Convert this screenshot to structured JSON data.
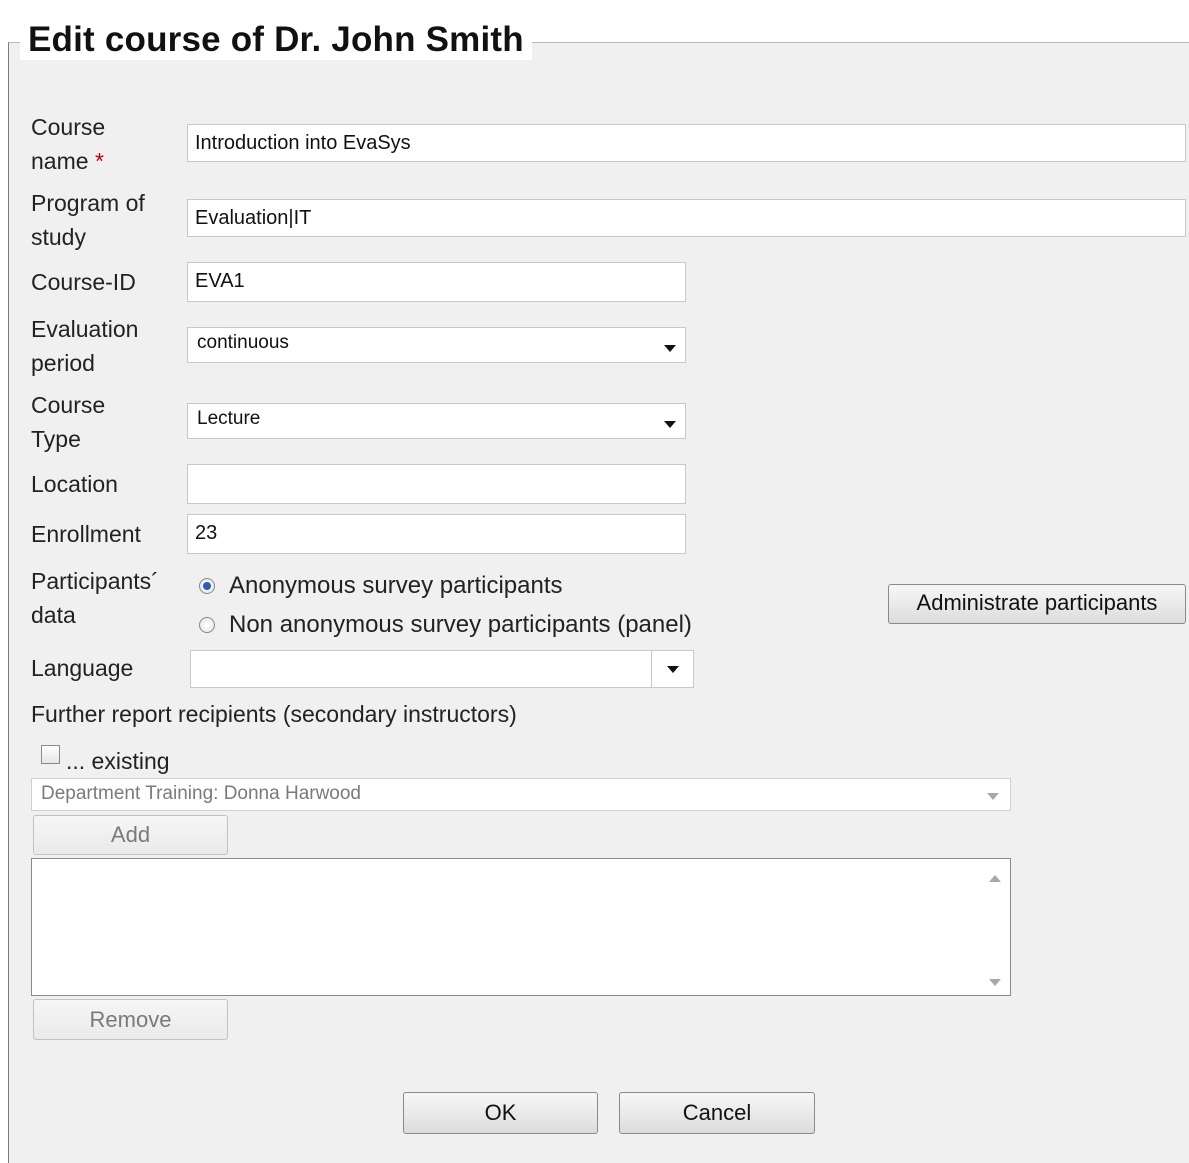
{
  "title": "Edit course of Dr. John Smith",
  "fields": {
    "course_name": {
      "label": "Course name",
      "required_mark": "*",
      "value": "Introduction into EvaSys"
    },
    "program": {
      "label": "Program of study",
      "value": "Evaluation|IT"
    },
    "course_id": {
      "label": "Course-ID",
      "value": "EVA1"
    },
    "evaluation_period": {
      "label": "Evaluation period",
      "value": "continuous"
    },
    "course_type": {
      "label": "Course Type",
      "value": "Lecture"
    },
    "location": {
      "label": "Location",
      "value": ""
    },
    "enrollment": {
      "label": "Enrollment",
      "value": "23"
    },
    "participants": {
      "label": "Participants´ data",
      "option_anonymous": "Anonymous survey participants",
      "option_panel": "Non anonymous survey participants (panel)",
      "selected": "anonymous",
      "admin_button": "Administrate participants"
    },
    "language": {
      "label": "Language",
      "value": ""
    }
  },
  "recipients": {
    "heading": "Further report recipients (secondary instructors)",
    "existing_label": "... existing",
    "existing_checked": false,
    "select_value": "Department Training: Donna Harwood",
    "add_button": "Add",
    "list_items": [],
    "remove_button": "Remove"
  },
  "footer": {
    "ok": "OK",
    "cancel": "Cancel"
  },
  "colors": {
    "required": "#cc0000",
    "panel_bg": "#f0f0f0",
    "radio_selected": "#2a5db0"
  }
}
